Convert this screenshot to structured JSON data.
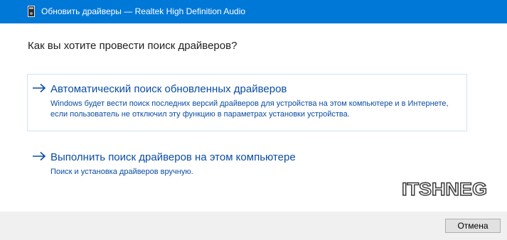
{
  "window": {
    "title": "Обновить драйверы — Realtek High Definition Audio",
    "titlebar_color": "#0078d7",
    "icon": "device-manager-icon"
  },
  "main": {
    "heading": "Как вы хотите провести поиск драйверов?",
    "options": [
      {
        "title": "Автоматический поиск обновленных драйверов",
        "description": "Windows будет вести поиск последних версий драйверов для устройства на этом компьютере и в Интернете, если пользователь не отключил эту функцию в параметрах установки устройства.",
        "icon": "arrow-right-icon"
      },
      {
        "title": "Выполнить поиск драйверов на этом компьютере",
        "description": "Поиск и установка драйверов вручную.",
        "icon": "arrow-right-icon"
      }
    ],
    "link_color": "#0a4da3"
  },
  "watermark": {
    "text": "ITSHNEG"
  },
  "footer": {
    "cancel_label": "Отмена"
  }
}
